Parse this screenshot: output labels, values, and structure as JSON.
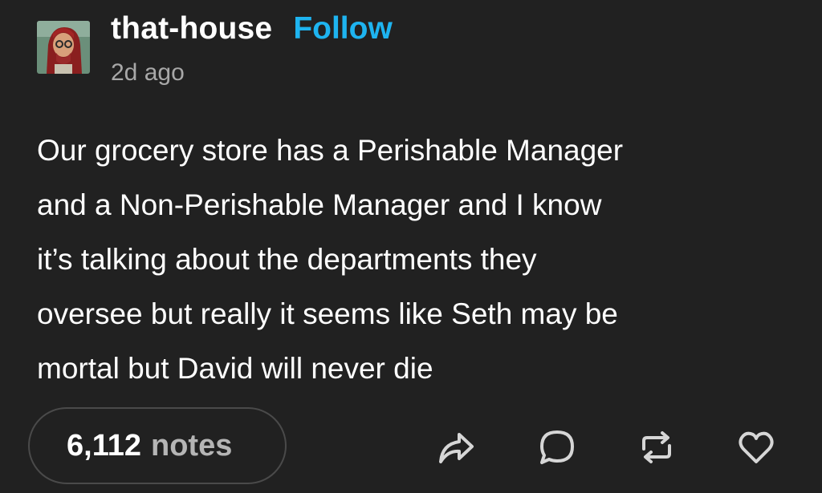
{
  "post": {
    "blog_name": "that-house",
    "follow_label": "Follow",
    "timestamp": "2d ago",
    "body_lines": [
      "Our grocery store has a Perishable Manager",
      "and a Non-Perishable Manager and I know",
      "it’s talking about the departments they",
      "oversee but really it seems like Seth may be",
      "mortal but David will never die"
    ]
  },
  "footer": {
    "notes_count": "6,112",
    "notes_label": "notes",
    "actions": [
      {
        "icon": "share-icon"
      },
      {
        "icon": "reply-icon"
      },
      {
        "icon": "reblog-icon"
      },
      {
        "icon": "like-icon"
      }
    ]
  },
  "colors": {
    "background": "#212121",
    "accent": "#1eb4f0",
    "secondary_text": "#a8a8a8"
  }
}
